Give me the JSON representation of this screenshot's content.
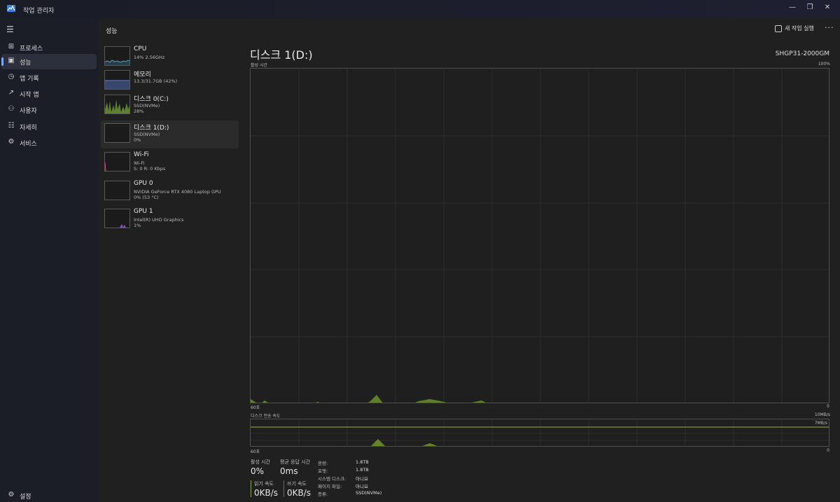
{
  "window": {
    "title": "작업 관리자",
    "controls": [
      "—",
      "❐",
      "✕"
    ]
  },
  "nav": {
    "items": [
      {
        "label": "프로세스",
        "icon": "processes-icon",
        "active": false
      },
      {
        "label": "성능",
        "icon": "performance-icon",
        "active": true
      },
      {
        "label": "앱 기록",
        "icon": "app-history-icon",
        "active": false
      },
      {
        "label": "시작 앱",
        "icon": "startup-apps-icon",
        "active": false
      },
      {
        "label": "사용자",
        "icon": "users-icon",
        "active": false
      },
      {
        "label": "자세히",
        "icon": "details-icon",
        "active": false
      },
      {
        "label": "서비스",
        "icon": "services-icon",
        "active": false
      }
    ],
    "settings_label": "설정"
  },
  "header": {
    "title": "성능",
    "run_task_label": "새 작업 실행",
    "more_label": "···"
  },
  "resources": [
    {
      "name": "CPU",
      "sub1": "14% 2.56GHz",
      "sub2": "",
      "color": "#4fa3c8"
    },
    {
      "name": "메모리",
      "sub1": "13.3/31.7GB (42%)",
      "sub2": "",
      "color": "#5c7fd0"
    },
    {
      "name": "디스크 0(C:)",
      "sub1": "SSD(NVMe)",
      "sub2": "28%",
      "color": "#8cc63f"
    },
    {
      "name": "디스크 1(D:)",
      "sub1": "SSD(NVMe)",
      "sub2": "0%",
      "color": "#8cc63f"
    },
    {
      "name": "Wi-Fi",
      "sub1": "Wi-Fi",
      "sub2": "S: 0 R: 0 Kbps",
      "color": "#c8508c"
    },
    {
      "name": "GPU 0",
      "sub1": "NVIDIA GeForce RTX 4080 Laptop GPU",
      "sub2": "0% (53 °C)",
      "color": "#9a5fd0"
    },
    {
      "name": "GPU 1",
      "sub1": "Intel(R) UHD Graphics",
      "sub2": "1%",
      "color": "#9a5fd0"
    }
  ],
  "detail": {
    "title": "디스크 1(D:)",
    "model": "SHGP31-2000GM",
    "active_graph": {
      "label": "활성 시간",
      "max_label": "100%",
      "time_left": "60초",
      "time_right": "0"
    },
    "transfer_graph": {
      "label": "디스크 전송 속도",
      "max_label": "10MB/s",
      "line_label": "7MB/s",
      "time_left": "60초",
      "time_right": "0"
    },
    "stats": {
      "active_time_label": "활성 시간",
      "active_time_value": "0%",
      "avg_response_label": "평균 응답 시간",
      "avg_response_value": "0ms",
      "read_speed_label": "읽기 속도",
      "read_speed_value": "0KB/s",
      "write_speed_label": "쓰기 속도",
      "write_speed_value": "0KB/s"
    },
    "properties": [
      {
        "key": "용량:",
        "value": "1.8TB"
      },
      {
        "key": "포맷:",
        "value": "1.8TB"
      },
      {
        "key": "시스템 디스크:",
        "value": "아니요"
      },
      {
        "key": "페이지 파일:",
        "value": "아니요"
      },
      {
        "key": "종류:",
        "value": "SSD(NVMe)"
      }
    ]
  },
  "colors": {
    "accent_disk": "#8cc63f",
    "nav_indicator": "#7aa7ff"
  }
}
